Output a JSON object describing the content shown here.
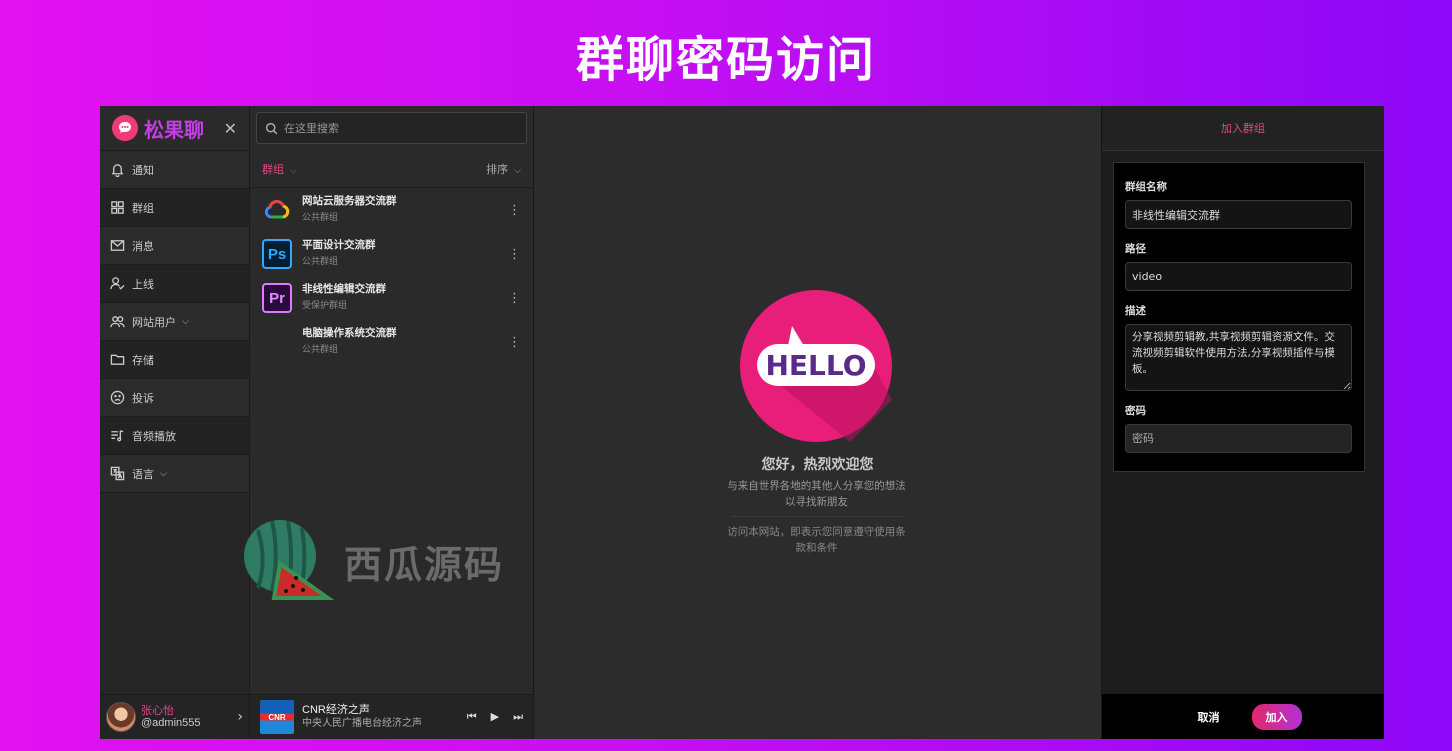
{
  "banner": {
    "title": "群聊密码访问"
  },
  "brand": {
    "name": "松果聊",
    "close_glyph": "✕"
  },
  "nav": {
    "items": [
      {
        "label": "通知",
        "icon": "bell-icon"
      },
      {
        "label": "群组",
        "icon": "grid-icon"
      },
      {
        "label": "消息",
        "icon": "mail-icon"
      },
      {
        "label": "上线",
        "icon": "user-check-icon"
      },
      {
        "label": "网站用户",
        "icon": "users-icon"
      },
      {
        "label": "存储",
        "icon": "folder-icon"
      },
      {
        "label": "投诉",
        "icon": "frown-icon"
      },
      {
        "label": "音频播放",
        "icon": "music-list-icon"
      },
      {
        "label": "语言",
        "icon": "translate-icon"
      }
    ]
  },
  "user": {
    "name": "张心怡",
    "handle": "@admin555"
  },
  "search": {
    "placeholder": "在这里搜索"
  },
  "list": {
    "tab_label": "群组",
    "sort_label": "排序",
    "groups": [
      {
        "name": "网站云服务器交流群",
        "type": "公共群组",
        "icon": "google-cloud-icon"
      },
      {
        "name": "平面设计交流群",
        "type": "公共群组",
        "icon": "photoshop-icon",
        "icon_text": "Ps"
      },
      {
        "name": "非线性编辑交流群",
        "type": "受保护群组",
        "icon": "premiere-icon",
        "icon_text": "Pr"
      },
      {
        "name": "电脑操作系统交流群",
        "type": "公共群组",
        "icon": "windows-icon"
      }
    ]
  },
  "watermark": {
    "text": "西瓜源码"
  },
  "player": {
    "title": "CNR经济之声",
    "subtitle": "中央人民广播电台经济之声",
    "cover_text": "CNR"
  },
  "welcome": {
    "hello_text": "HELLO",
    "title": "您好，热烈欢迎您",
    "subtitle": "与来自世界各地的其他人分享您的想法以寻找新朋友",
    "terms": "访问本网站，即表示您同意遵守使用条款和条件"
  },
  "join_panel": {
    "title": "加入群组",
    "fields": {
      "name_label": "群组名称",
      "name_value": "非线性编辑交流群",
      "path_label": "路径",
      "path_value": "video",
      "desc_label": "描述",
      "desc_value": "分享视频剪辑教,共享视频剪辑资源文件。交流视频剪辑软件使用方法,分享视频插件与模板。",
      "password_label": "密码",
      "password_placeholder": "密码"
    },
    "cancel_label": "取消",
    "join_label": "加入"
  },
  "colors": {
    "accent": "#e0488a",
    "brand_purple": "#c43ee6",
    "hello_pink": "#e91e7a"
  }
}
